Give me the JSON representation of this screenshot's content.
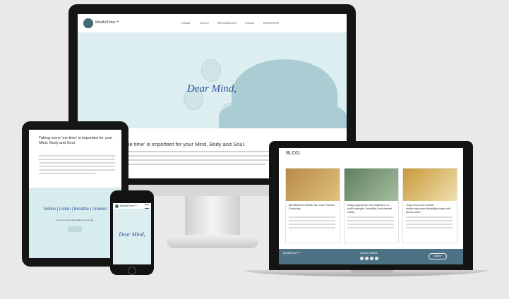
{
  "site": {
    "logo_text": "MindfulTimer™",
    "nav": [
      "HOME",
      "BLOG",
      "RESOURCES",
      "LOGIN",
      "REGISTER"
    ],
    "hero_title": "Dear Mind,",
    "section_title_desktop": "'me time' is important for your Mind, Body and Soul.",
    "section_title_tablet": "Taking some 'me time' is important for your Mind, Body and Soul.",
    "notice_strip": "Notice | Listen | Breathe | Unwind",
    "tagline": "A tool for help bring balance to your life.",
    "phone_logo_text": "MindfulTimer™",
    "phone_hero_title": "Dear Mind,"
  },
  "blog": {
    "title": "BLOG.",
    "cards": [
      {
        "title": "Mindfulness Habits You Can Practice Everyday",
        "accent": "#c9a86a"
      },
      {
        "title": "Easy yoga poses for beginners to build strength, flexibility, and mental clarity",
        "accent": "#8fa88f"
      },
      {
        "title": "Yoga improves mental health,improves flexibility,helps with stress relief",
        "accent": "#d8b35a"
      }
    ],
    "footer": {
      "brand": "MindfulTimer™",
      "social_label": "SOCIAL MEDIA",
      "newsletter_button": "SUBMIT"
    }
  },
  "colors": {
    "accent_blue": "#2d4e9a",
    "hero_bg": "#dceef0",
    "silhouette": "#a9cdd2",
    "footer_bg": "#4e7285",
    "device_black": "#151515",
    "page_bg": "#e9e9e9"
  }
}
